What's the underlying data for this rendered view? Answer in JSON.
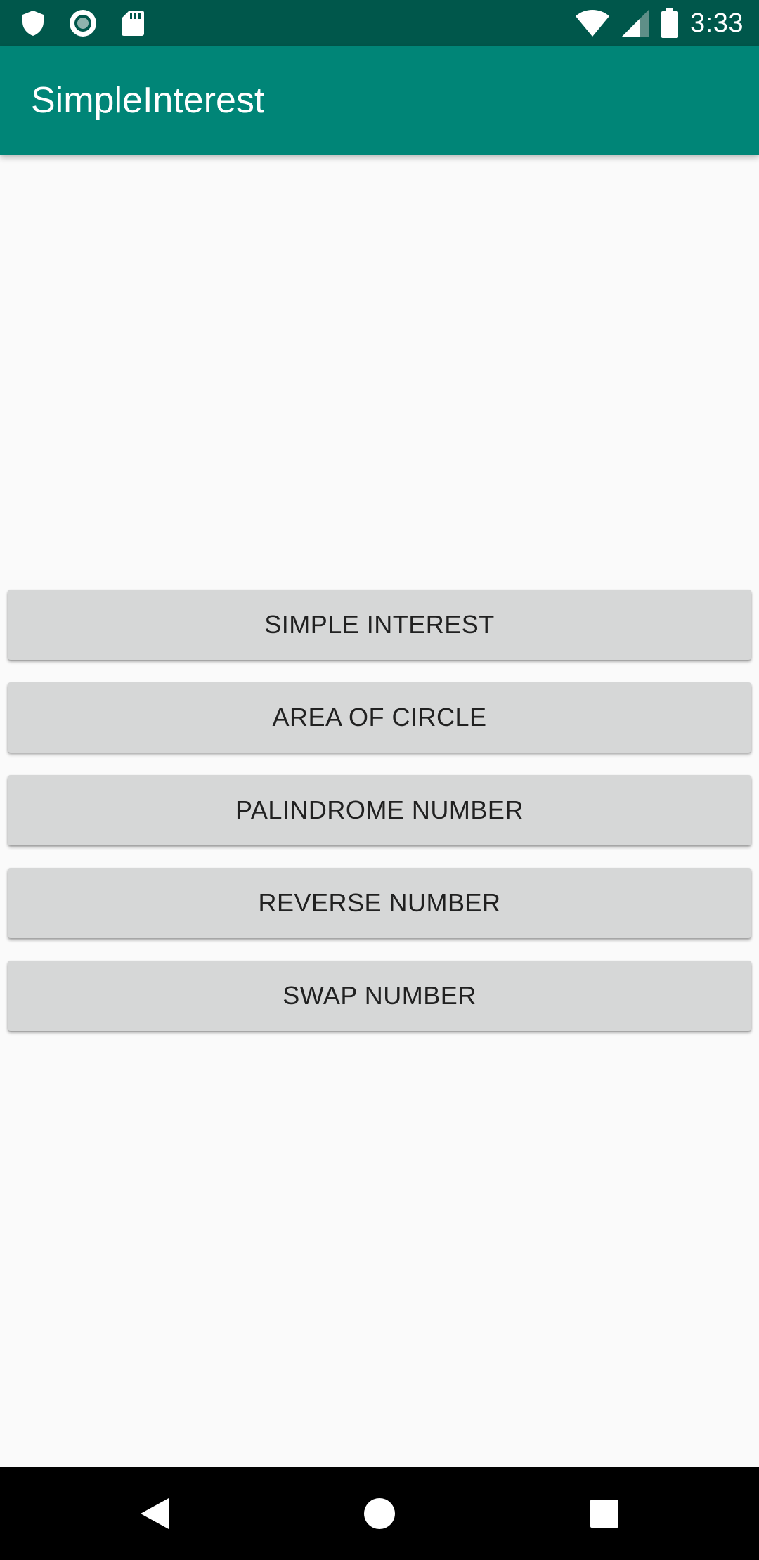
{
  "status_bar": {
    "time": "3:33",
    "left_icons": [
      "shield-icon",
      "record-icon",
      "sd-card-icon"
    ],
    "right_icons": [
      "wifi-icon",
      "cell-signal-icon",
      "battery-icon"
    ]
  },
  "app_bar": {
    "title": "SimpleInterest",
    "background_color": "#008577",
    "status_color": "#00574b"
  },
  "buttons": [
    {
      "label": "SIMPLE INTEREST"
    },
    {
      "label": "AREA OF CIRCLE"
    },
    {
      "label": "PALINDROME NUMBER"
    },
    {
      "label": "REVERSE NUMBER"
    },
    {
      "label": "SWAP NUMBER"
    }
  ],
  "nav_bar": {
    "icons": [
      "back-icon",
      "home-icon",
      "recents-icon"
    ]
  }
}
